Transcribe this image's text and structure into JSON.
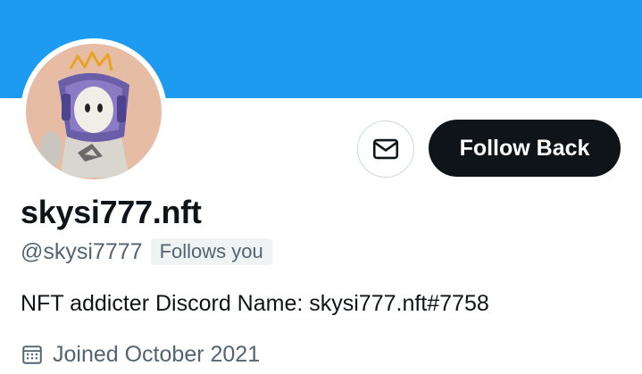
{
  "profile": {
    "display_name": "skysi777.nft",
    "handle": "@skysi7777",
    "follows_you": "Follows you",
    "bio": "NFT addicter Discord Name: skysi777.nft#7758",
    "joined": "Joined October 2021"
  },
  "actions": {
    "follow_back": "Follow Back",
    "message_icon": "envelope-icon"
  },
  "colors": {
    "banner": "#1d9bf0",
    "button_dark": "#0f1419",
    "secondary_text": "#536471",
    "avatar_bg": "#e7bca4"
  }
}
